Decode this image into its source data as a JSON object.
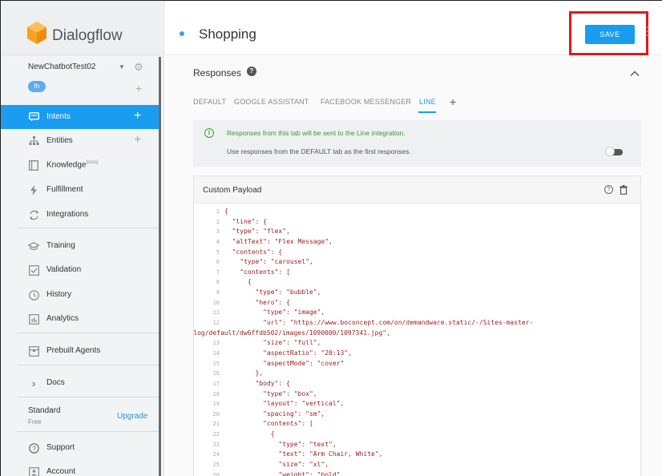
{
  "app": {
    "logo_text": "Dialogflow",
    "agent_name": "NewChatbotTest02",
    "language_chip": "th"
  },
  "sidebar": {
    "items": [
      {
        "label": "Intents",
        "icon": "chat-bubble-icon",
        "active": true,
        "has_add": true
      },
      {
        "label": "Entities",
        "icon": "hierarchy-icon",
        "active": false,
        "has_add": true
      },
      {
        "label": "Knowledge",
        "icon": "book-icon",
        "active": false,
        "has_add": false,
        "badge": "[beta]"
      },
      {
        "label": "Fulfillment",
        "icon": "bolt-icon",
        "active": false,
        "has_add": false
      },
      {
        "label": "Integrations",
        "icon": "sync-icon",
        "active": false,
        "has_add": false
      },
      {
        "label": "Training",
        "icon": "graduation-cap-icon",
        "active": false,
        "has_add": false
      },
      {
        "label": "Validation",
        "icon": "checkbox-icon",
        "active": false,
        "has_add": false
      },
      {
        "label": "History",
        "icon": "clock-icon",
        "active": false,
        "has_add": false
      },
      {
        "label": "Analytics",
        "icon": "bar-chart-icon",
        "active": false,
        "has_add": false
      },
      {
        "label": "Prebuilt Agents",
        "icon": "package-icon",
        "active": false,
        "has_add": false
      },
      {
        "label": "Docs",
        "icon": "chevron-right-icon",
        "active": false,
        "has_add": false
      }
    ],
    "plan": {
      "name": "Standard",
      "tier": "Free",
      "upgrade_label": "Upgrade"
    },
    "footer_items": [
      {
        "label": "Support",
        "icon": "question-icon"
      },
      {
        "label": "Account",
        "icon": "account-icon"
      }
    ]
  },
  "header": {
    "intent_name": "Shopping",
    "save_label": "SAVE"
  },
  "responses": {
    "title": "Responses",
    "tabs": [
      "DEFAULT",
      "GOOGLE ASSISTANT",
      "FACEBOOK MESSENGER",
      "LINE"
    ],
    "active_tab": "LINE",
    "info_line1": "Responses from this tab will be sent to the Line integration.",
    "info_line2": "Use responses from the DEFAULT tab as the first responses.",
    "payload_title": "Custom Payload"
  },
  "code_lines": [
    {
      "n": "1",
      "t": "{"
    },
    {
      "n": "2",
      "t": "  \"line\": {"
    },
    {
      "n": "3",
      "t": "  \"type\": \"flex\","
    },
    {
      "n": "4",
      "t": "  \"altText\": \"Flex Message\","
    },
    {
      "n": "5",
      "t": "  \"contents\": {"
    },
    {
      "n": "6",
      "t": "    \"type\": \"carousel\","
    },
    {
      "n": "7",
      "t": "    \"contents\": ["
    },
    {
      "n": "8",
      "t": "      {"
    },
    {
      "n": "9",
      "t": "        \"type\": \"bubble\","
    },
    {
      "n": "10",
      "t": "        \"hero\": {"
    },
    {
      "n": "11",
      "t": "          \"type\": \"image\","
    },
    {
      "n": "12",
      "t": "          \"url\": \"https://www.boconcept.com/on/demandware.static/-/Sites-master-"
    },
    {
      "n": "",
      "t": "catalog/default/dw6ffdb502/images/1090000/1097341.jpg\",",
      "wrap": true
    },
    {
      "n": "13",
      "t": "          \"size\": \"full\","
    },
    {
      "n": "14",
      "t": "          \"aspectRatio\": \"20:13\","
    },
    {
      "n": "15",
      "t": "          \"aspectMode\": \"cover\""
    },
    {
      "n": "16",
      "t": "        },"
    },
    {
      "n": "17",
      "t": "        \"body\": {"
    },
    {
      "n": "18",
      "t": "          \"type\": \"box\","
    },
    {
      "n": "19",
      "t": "          \"layout\": \"vertical\","
    },
    {
      "n": "20",
      "t": "          \"spacing\": \"sm\","
    },
    {
      "n": "21",
      "t": "          \"contents\": ["
    },
    {
      "n": "22",
      "t": "            {"
    },
    {
      "n": "23",
      "t": "              \"type\": \"text\","
    },
    {
      "n": "24",
      "t": "              \"text\": \"Arm Chair, White\","
    },
    {
      "n": "25",
      "t": "              \"size\": \"xl\","
    },
    {
      "n": "26",
      "t": "              \"weight\": \"bold\","
    }
  ],
  "colors": {
    "accent": "#1a9cf0",
    "highlight_box": "#e8141c",
    "code_string": "#9b1b1b",
    "info_green": "#3a9a3a"
  }
}
